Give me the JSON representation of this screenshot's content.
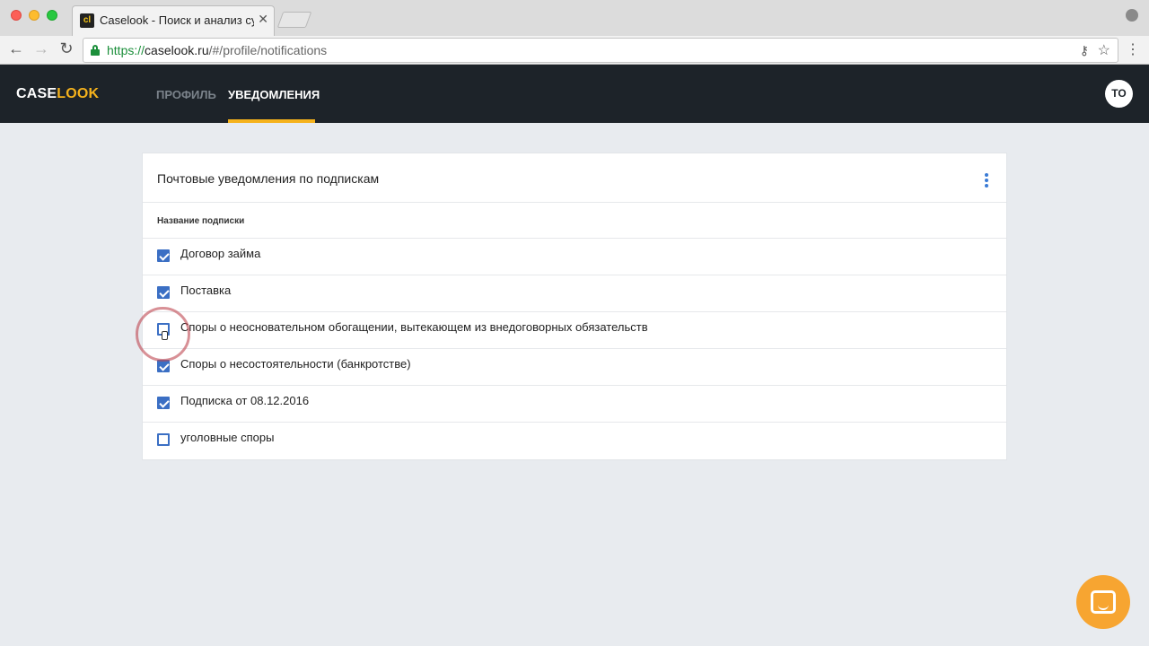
{
  "browser": {
    "tab_title": "Caselook - Поиск и анализ су",
    "tab_favicon_text": "cl",
    "tab_close": "✕",
    "url_scheme": "https://",
    "url_host": "caselook.ru",
    "url_path": "/#/profile/notifications",
    "back": "←",
    "forward": "→",
    "reload": "↻",
    "key": "⚷",
    "star": "☆",
    "menu": "⋮"
  },
  "app": {
    "logo_case": "CASE",
    "logo_look": "LOOK",
    "nav": {
      "profile": "ПРОФИЛЬ",
      "notifications": "УВЕДОМЛЕНИЯ"
    },
    "avatar_initials": "TO",
    "accent_color": "#f5b21c"
  },
  "card": {
    "title": "Почтовые уведомления по подпискам",
    "column_header": "Название подписки",
    "subscriptions": [
      {
        "label": "Договор займа",
        "checked": true
      },
      {
        "label": "Поставка",
        "checked": true
      },
      {
        "label": "Споры о неосновательном обогащении, вытекающем из внедоговорных обязательств",
        "checked": false
      },
      {
        "label": "Споры о несостоятельности (банкротстве)",
        "checked": true
      },
      {
        "label": "Подписка от 08.12.2016",
        "checked": true
      },
      {
        "label": "уголовные споры",
        "checked": false
      }
    ]
  }
}
